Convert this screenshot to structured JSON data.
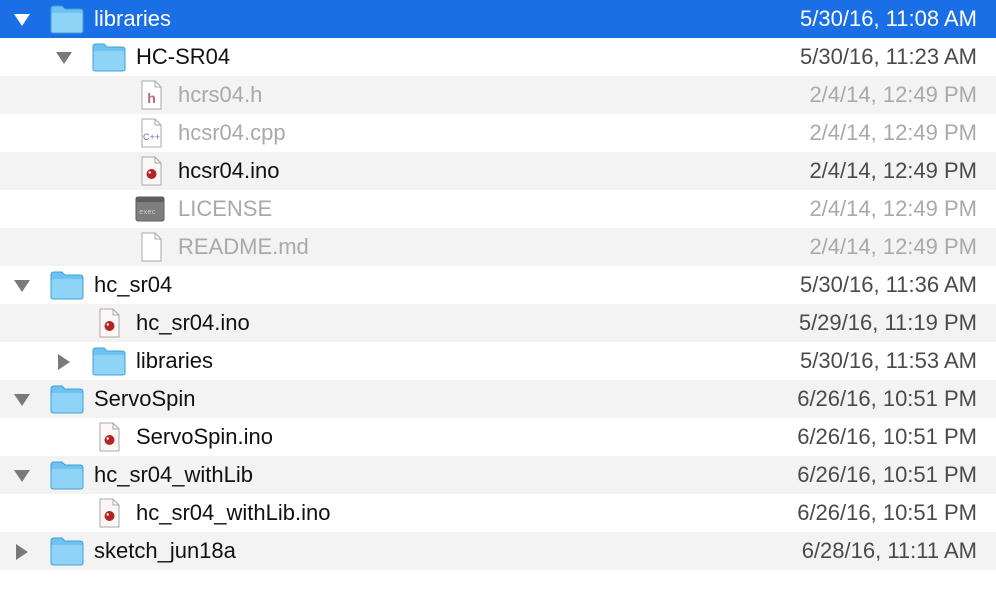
{
  "rows": [
    {
      "name": "libraries",
      "date": "5/30/16, 11:08 AM",
      "kind": "folder",
      "disclosure": "expanded",
      "level": 0,
      "selected": true,
      "alt": false,
      "dim": false
    },
    {
      "name": "HC-SR04",
      "date": "5/30/16, 11:23 AM",
      "kind": "folder",
      "disclosure": "expanded",
      "level": 1,
      "selected": false,
      "alt": false,
      "dim": false
    },
    {
      "name": "hcrs04.h",
      "date": "2/4/14, 12:49 PM",
      "kind": "h",
      "disclosure": "none",
      "level": 2,
      "selected": false,
      "alt": true,
      "dim": true
    },
    {
      "name": "hcsr04.cpp",
      "date": "2/4/14, 12:49 PM",
      "kind": "cpp",
      "disclosure": "none",
      "level": 2,
      "selected": false,
      "alt": false,
      "dim": true
    },
    {
      "name": "hcsr04.ino",
      "date": "2/4/14, 12:49 PM",
      "kind": "ino",
      "disclosure": "none",
      "level": 2,
      "selected": false,
      "alt": true,
      "dim": false
    },
    {
      "name": "LICENSE",
      "date": "2/4/14, 12:49 PM",
      "kind": "exec",
      "disclosure": "none",
      "level": 2,
      "selected": false,
      "alt": false,
      "dim": true
    },
    {
      "name": "README.md",
      "date": "2/4/14, 12:49 PM",
      "kind": "doc",
      "disclosure": "none",
      "level": 2,
      "selected": false,
      "alt": true,
      "dim": true
    },
    {
      "name": "hc_sr04",
      "date": "5/30/16, 11:36 AM",
      "kind": "folder",
      "disclosure": "expanded",
      "level": 0,
      "selected": false,
      "alt": false,
      "dim": false
    },
    {
      "name": "hc_sr04.ino",
      "date": "5/29/16, 11:19 PM",
      "kind": "ino",
      "disclosure": "none",
      "level": 1,
      "selected": false,
      "alt": true,
      "dim": false
    },
    {
      "name": "libraries",
      "date": "5/30/16, 11:53 AM",
      "kind": "folder",
      "disclosure": "collapsed",
      "level": 1,
      "selected": false,
      "alt": false,
      "dim": false
    },
    {
      "name": "ServoSpin",
      "date": "6/26/16, 10:51 PM",
      "kind": "folder",
      "disclosure": "expanded",
      "level": 0,
      "selected": false,
      "alt": true,
      "dim": false
    },
    {
      "name": "ServoSpin.ino",
      "date": "6/26/16, 10:51 PM",
      "kind": "ino",
      "disclosure": "none",
      "level": 1,
      "selected": false,
      "alt": false,
      "dim": false
    },
    {
      "name": "hc_sr04_withLib",
      "date": "6/26/16, 10:51 PM",
      "kind": "folder",
      "disclosure": "expanded",
      "level": 0,
      "selected": false,
      "alt": true,
      "dim": false
    },
    {
      "name": "hc_sr04_withLib.ino",
      "date": "6/26/16, 10:51 PM",
      "kind": "ino",
      "disclosure": "none",
      "level": 1,
      "selected": false,
      "alt": false,
      "dim": false
    },
    {
      "name": "sketch_jun18a",
      "date": "6/28/16, 11:11 AM",
      "kind": "folder",
      "disclosure": "collapsed",
      "level": 0,
      "selected": false,
      "alt": true,
      "dim": false
    }
  ],
  "colors": {
    "selection": "#1a6ee6",
    "folder": "#6cc3f2",
    "ino": "#b32424",
    "stripe": "#f3f3f3"
  },
  "icons": {
    "folder": "folder-icon",
    "h": "header-file-icon",
    "cpp": "cpp-file-icon",
    "ino": "arduino-sketch-icon",
    "exec": "executable-file-icon",
    "doc": "document-icon"
  }
}
